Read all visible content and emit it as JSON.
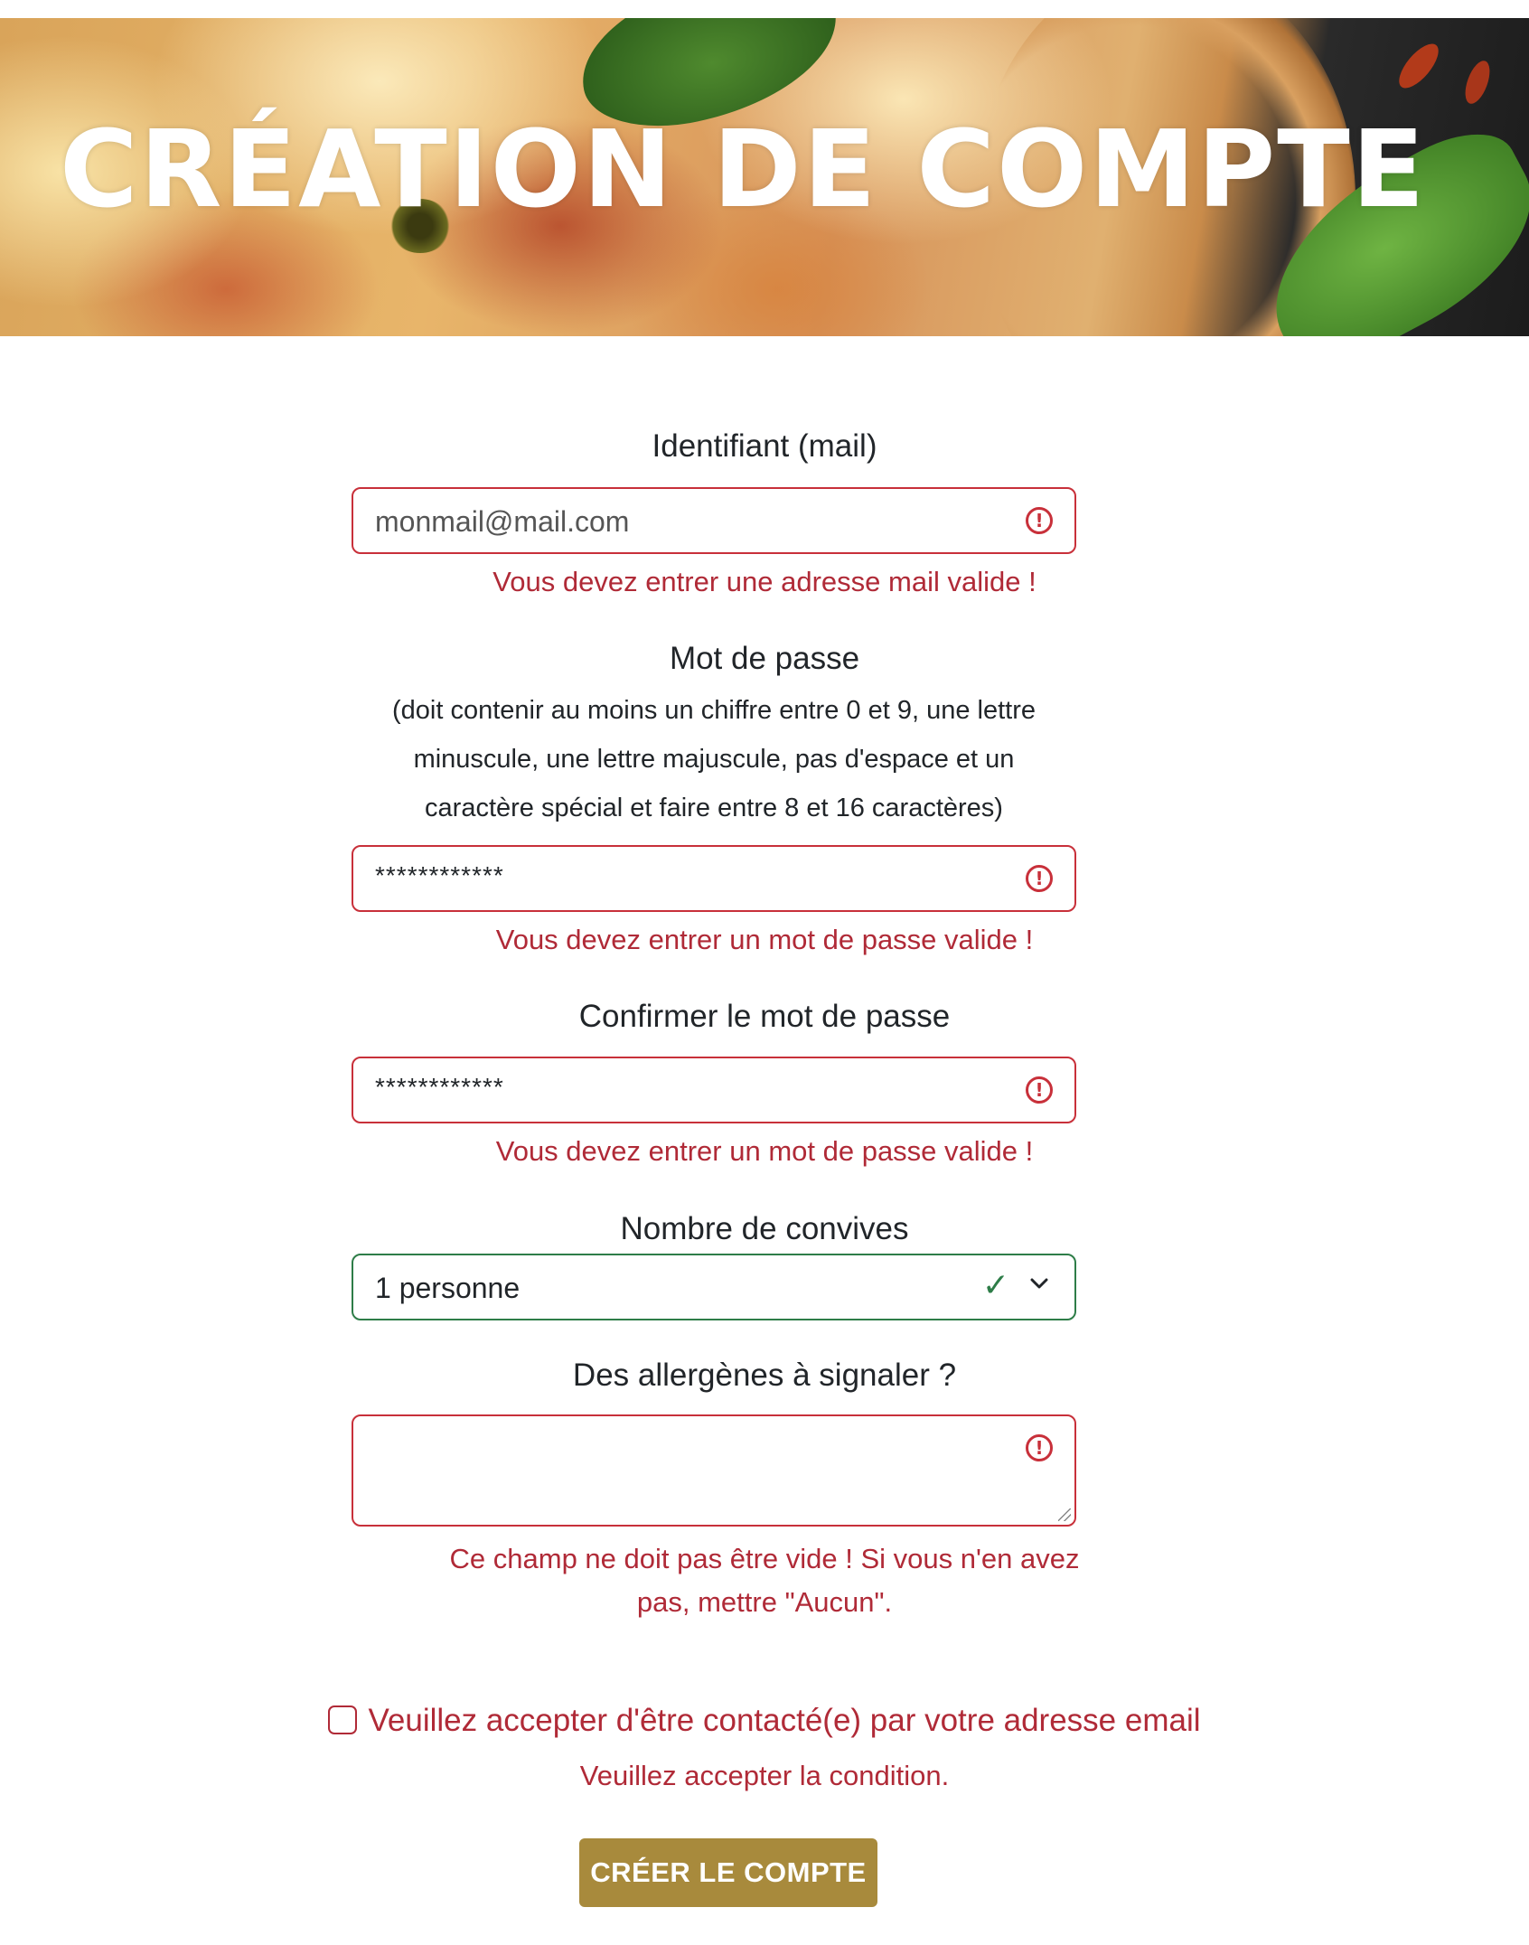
{
  "header": {
    "title": "CRÉATION DE COMPTE"
  },
  "email": {
    "label": "Identifiant (mail)",
    "value": "monmail@mail.com",
    "error": "Vous devez entrer une adresse mail valide !"
  },
  "password": {
    "label": "Mot de passe",
    "help_lines": [
      "(doit contenir au moins un chiffre entre 0 et 9, une lettre",
      "minuscule, une lettre majuscule, pas d'espace et un",
      "caractère spécial et faire entre 8 et 16 caractères)"
    ],
    "value": "************",
    "error": "Vous devez entrer un mot de passe valide !"
  },
  "confirm_password": {
    "label": "Confirmer le mot de passe",
    "value": "************",
    "error": "Vous devez entrer un mot de passe valide !"
  },
  "guests": {
    "label": "Nombre de convives",
    "selected": "1 personne"
  },
  "allergens": {
    "label": "Des allergènes à signaler ?",
    "value": "",
    "error_lines": [
      "Ce champ ne doit pas être vide ! Si vous n'en avez",
      "pas, mettre \"Aucun\"."
    ]
  },
  "consent": {
    "label": "Veuillez accepter d'être contacté(e) par votre adresse email",
    "error": "Veuillez accepter la condition.",
    "checked": false
  },
  "submit": {
    "label": "CRÉER LE COMPTE"
  },
  "colors": {
    "error": "#b02a37",
    "success": "#2e7d48",
    "button": "#a88a3c"
  }
}
